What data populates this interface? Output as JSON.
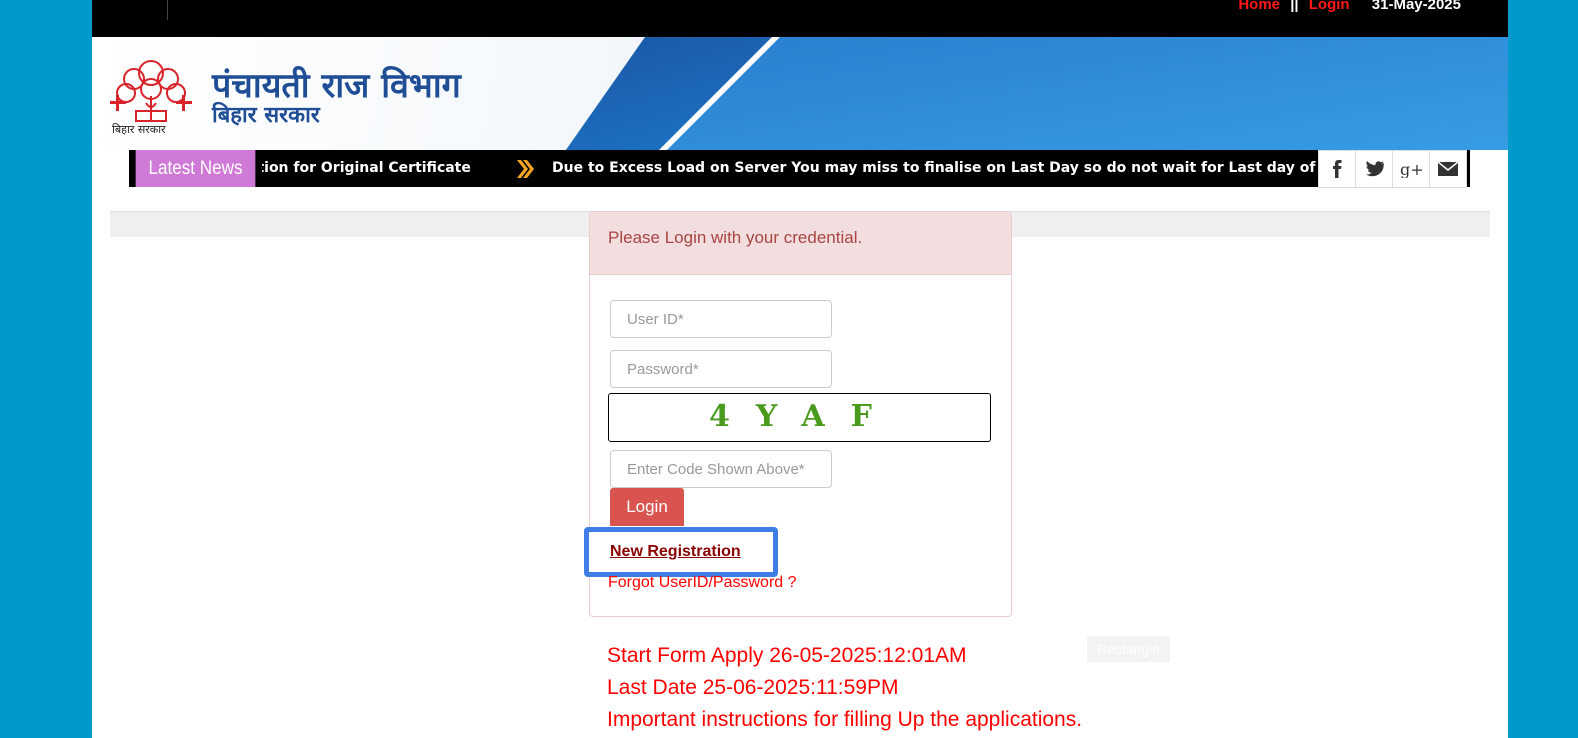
{
  "topbar": {
    "home_label": "Home",
    "separator": "||",
    "login_label": "Login",
    "date": "31-May-2025"
  },
  "banner": {
    "title": "पंचायती राज विभाग",
    "subtitle": "बिहार सरकार",
    "logo_caption": "बिहार सरकार",
    "colors": {
      "title": "#1f4e96",
      "swoosh": "#1f78cc"
    }
  },
  "news": {
    "label": "Latest News",
    "items": [
      "ation for Original Certificate",
      "Due to Excess Load on Server You may miss to finalise on Last Day so do not wait for Last day of Application."
    ],
    "arrow_icon": "double-chevron-right-icon"
  },
  "social": [
    {
      "name": "facebook-icon",
      "glyph": "f"
    },
    {
      "name": "twitter-icon",
      "glyph": "twitter"
    },
    {
      "name": "google-plus-icon",
      "glyph": "g+"
    },
    {
      "name": "mail-icon",
      "glyph": "envelope"
    }
  ],
  "login": {
    "heading": "Please Login with your credential.",
    "userid_placeholder": "User ID*",
    "password_placeholder": "Password*",
    "captcha_code": "4YAF",
    "code_placeholder": "Enter Code Shown Above*",
    "login_button": "Login",
    "new_registration": "New Registration",
    "forgot": "Forgot UserID/Password ?"
  },
  "info": {
    "start": "Start Form Apply 26-05-2025:12:01AM",
    "last": "Last Date 25-06-2025:11:59PM",
    "instructions": "Important instructions for filling Up the applications."
  },
  "rectangle_label": "Rectangle",
  "colors": {
    "background": "#0099cc",
    "accent_red": "#ff0000",
    "news_label": "#d07ad7",
    "login_button": "#d9534f",
    "highlight": "#3f7ee6"
  }
}
